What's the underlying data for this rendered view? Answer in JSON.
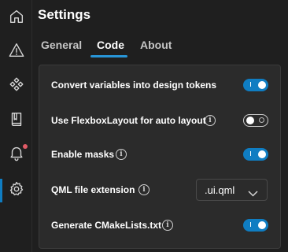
{
  "app": {
    "title": "Settings"
  },
  "rail": {
    "items": [
      {
        "icon": "home-icon"
      },
      {
        "icon": "warning-icon"
      },
      {
        "icon": "components-icon"
      },
      {
        "icon": "book-icon"
      },
      {
        "icon": "bell-icon",
        "badge": true
      },
      {
        "icon": "gear-icon",
        "active": true
      }
    ]
  },
  "tabs": [
    {
      "label": "General"
    },
    {
      "label": "Code",
      "active": true
    },
    {
      "label": "About"
    }
  ],
  "settings": {
    "convert_variables": {
      "label": "Convert variables into design tokens",
      "enabled": true
    },
    "flexbox_layout": {
      "label": "Use FlexboxLayout for auto layout",
      "enabled": false
    },
    "enable_masks": {
      "label": "Enable masks",
      "enabled": true
    },
    "qml_extension": {
      "label": "QML file extension",
      "value": ".ui.qml"
    },
    "generate_cmake": {
      "label": "Generate CMakeLists.txt",
      "enabled": true
    }
  },
  "colors": {
    "background": "#1f1f1f",
    "panel": "#2b2b2b",
    "accent": "#0f7dc2",
    "notification_dot": "#e05a66"
  }
}
